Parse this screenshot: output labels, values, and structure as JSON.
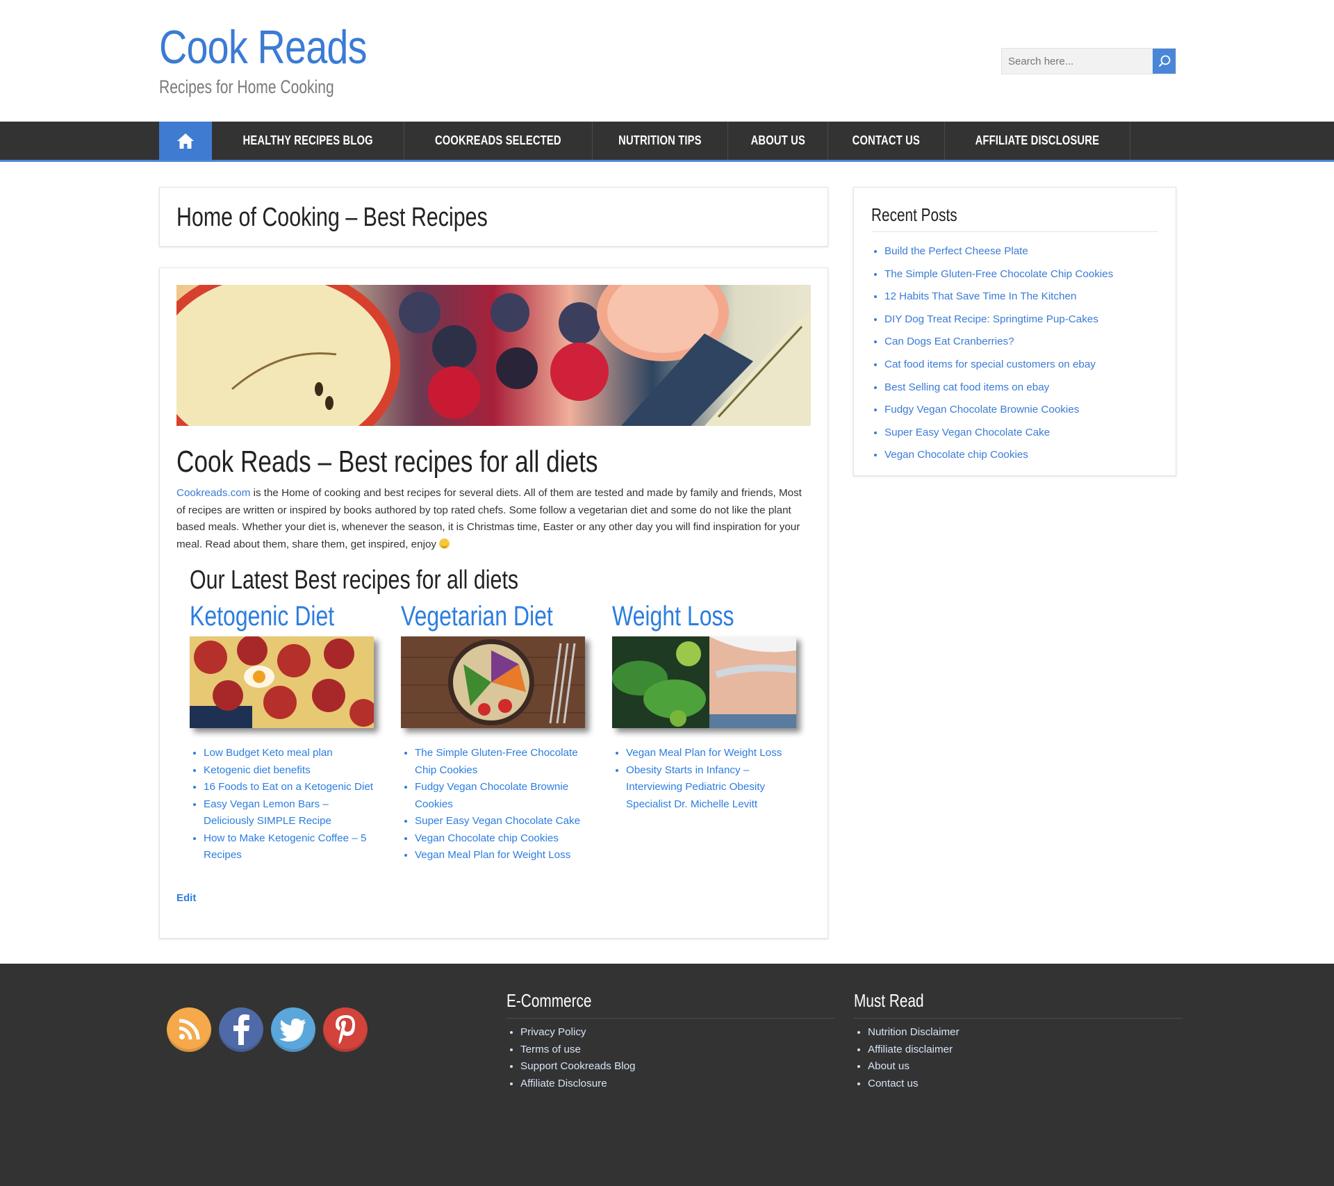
{
  "site": {
    "title": "Cook Reads",
    "tagline": "Recipes for Home Cooking"
  },
  "search": {
    "placeholder": "Search here...",
    "button_icon": "search-icon"
  },
  "nav": {
    "home_icon": "home-icon",
    "items": [
      {
        "label": "HEALTHY RECIPES BLOG"
      },
      {
        "label": "COOKREADS SELECTED"
      },
      {
        "label": "NUTRITION TIPS"
      },
      {
        "label": "ABOUT US"
      },
      {
        "label": "CONTACT US"
      },
      {
        "label": "AFFILIATE DISCLOSURE"
      }
    ]
  },
  "page": {
    "title": "Home of Cooking – Best Recipes"
  },
  "article": {
    "title": "Cook Reads – Best recipes for all diets",
    "intro_link": "Cookreads.com",
    "intro_text": " is the Home of cooking and best recipes for several diets. All of them are tested and made by family and friends, Most of recipes are written or inspired by books authored by top rated chefs. Some follow a vegetarian diet and some do not like the plant based meals. Whether your diet is, whenever the season, it is Christmas time, Easter or any other day you will find inspiration for your meal. Read about them, share them, get inspired, enjoy ",
    "latest_heading": "Our Latest Best recipes for all diets",
    "columns": [
      {
        "heading": "Ketogenic Diet",
        "links": [
          "Low Budget Keto meal plan",
          "Ketogenic diet benefits",
          "16 Foods to Eat on a Ketogenic Diet",
          "Easy Vegan Lemon Bars – Deliciously SIMPLE Recipe",
          "How to Make Ketogenic Coffee – 5 Recipes"
        ]
      },
      {
        "heading": "Vegetarian Diet",
        "links": [
          "The Simple Gluten-Free Chocolate Chip Cookies",
          "Fudgy Vegan Chocolate Brownie Cookies",
          "Super Easy Vegan Chocolate Cake",
          "Vegan Chocolate chip Cookies",
          "Vegan Meal Plan for Weight Loss"
        ]
      },
      {
        "heading": "Weight Loss",
        "links": [
          "Vegan Meal Plan for Weight Loss",
          "Obesity Starts in Infancy – Interviewing Pediatric Obesity Specialist Dr. Michelle Levitt"
        ]
      }
    ],
    "edit_label": "Edit"
  },
  "sidebar": {
    "title": "Recent Posts",
    "posts": [
      "Build the Perfect Cheese Plate",
      "The Simple Gluten-Free Chocolate Chip Cookies",
      "12 Habits That Save Time In The Kitchen",
      "DIY Dog Treat Recipe: Springtime Pup-Cakes",
      "Can Dogs Eat Cranberries?",
      "Cat food items for special customers on ebay",
      "Best Selling cat food items on ebay",
      "Fudgy Vegan Chocolate Brownie Cookies",
      "Super Easy Vegan Chocolate Cake",
      "Vegan Chocolate chip Cookies"
    ]
  },
  "footer": {
    "social_icons": [
      "rss-icon",
      "facebook-icon",
      "twitter-icon",
      "pinterest-icon"
    ],
    "ecommerce": {
      "title": "E-Commerce",
      "links": [
        "Privacy Policy",
        "Terms of use",
        "Support Cookreads Blog",
        "Affiliate Disclosure"
      ]
    },
    "must_read": {
      "title": "Must Read",
      "links": [
        "Nutrition Disclaimer",
        "Affiliate disclaimer",
        "About us",
        "Contact us"
      ]
    }
  },
  "colors": {
    "brand_blue": "#3a7bd5",
    "link_blue": "#2b7de0",
    "nav_bg": "#333333",
    "footer_bg": "#333333"
  }
}
